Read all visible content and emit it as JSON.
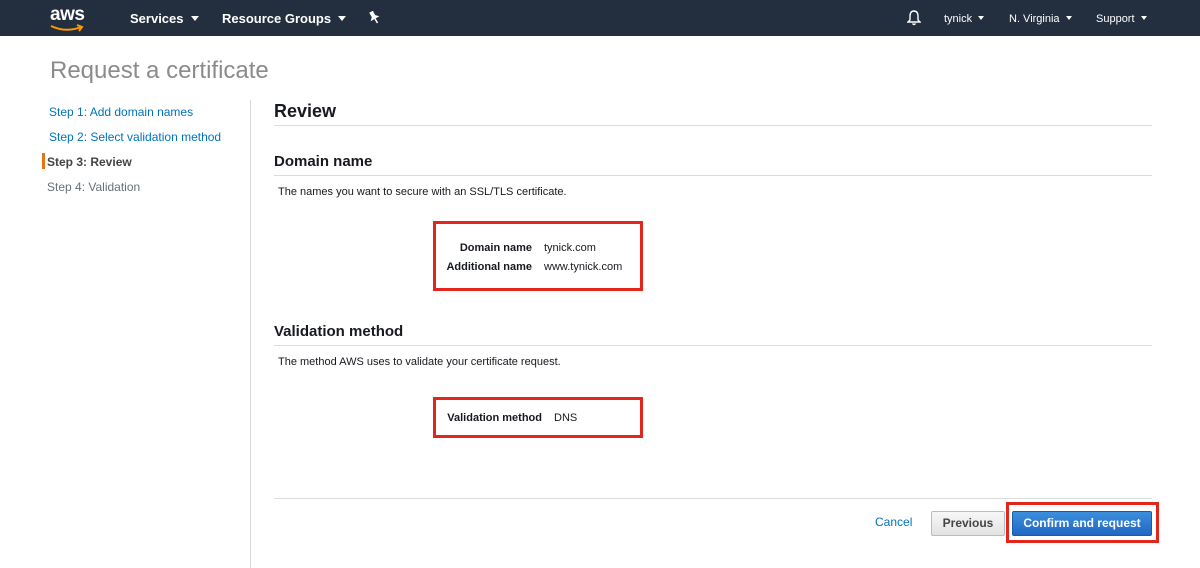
{
  "nav": {
    "logo_text": "aws",
    "services_label": "Services",
    "resource_groups_label": "Resource Groups",
    "user_label": "tynick",
    "region_label": "N. Virginia",
    "support_label": "Support"
  },
  "page": {
    "title": "Request a certificate"
  },
  "steps": [
    {
      "label": "Step 1: Add domain names",
      "state": "link"
    },
    {
      "label": "Step 2: Select validation method",
      "state": "link"
    },
    {
      "label": "Step 3: Review",
      "state": "current"
    },
    {
      "label": "Step 4: Validation",
      "state": "future"
    }
  ],
  "review": {
    "heading": "Review",
    "domain_section": {
      "heading": "Domain name",
      "description": "The names you want to secure with an SSL/TLS certificate.",
      "domain_name_label": "Domain name",
      "domain_name_value": "tynick.com",
      "additional_name_label": "Additional name",
      "additional_name_value": "www.tynick.com"
    },
    "validation_section": {
      "heading": "Validation method",
      "description": "The method AWS uses to validate your certificate request.",
      "method_label": "Validation method",
      "method_value": "DNS"
    }
  },
  "actions": {
    "cancel_label": "Cancel",
    "previous_label": "Previous",
    "confirm_label": "Confirm and request"
  },
  "colors": {
    "nav_bg": "#232f3e",
    "link": "#0073bb",
    "primary_button": "#2067c4",
    "highlight": "#e3261b",
    "step_marker": "#ec7211"
  }
}
